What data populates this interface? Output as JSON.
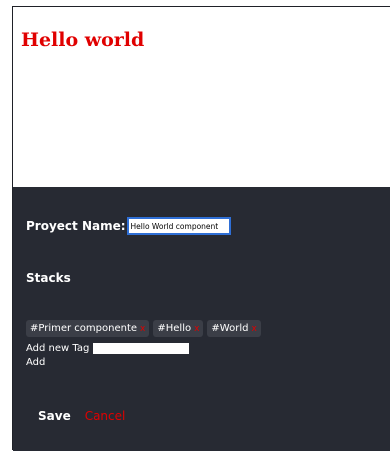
{
  "preview": {
    "heading": "Hello world"
  },
  "form": {
    "project_name_label": "Proyect Name:",
    "project_name_value": "Hello World component",
    "stacks_label": "Stacks",
    "tags": [
      {
        "label": "#Primer componente",
        "remove": "x"
      },
      {
        "label": "#Hello",
        "remove": "x"
      },
      {
        "label": "#World",
        "remove": "x"
      }
    ],
    "add_tag_label": "Add new Tag",
    "add_tag_value": "",
    "add_label": "Add"
  },
  "actions": {
    "save": "Save",
    "cancel": "Cancel"
  },
  "colors": {
    "accent_red": "#e00000",
    "panel_bg": "#272a33",
    "tag_bg": "#3b3e47",
    "focus_blue": "#2f6fd6"
  }
}
